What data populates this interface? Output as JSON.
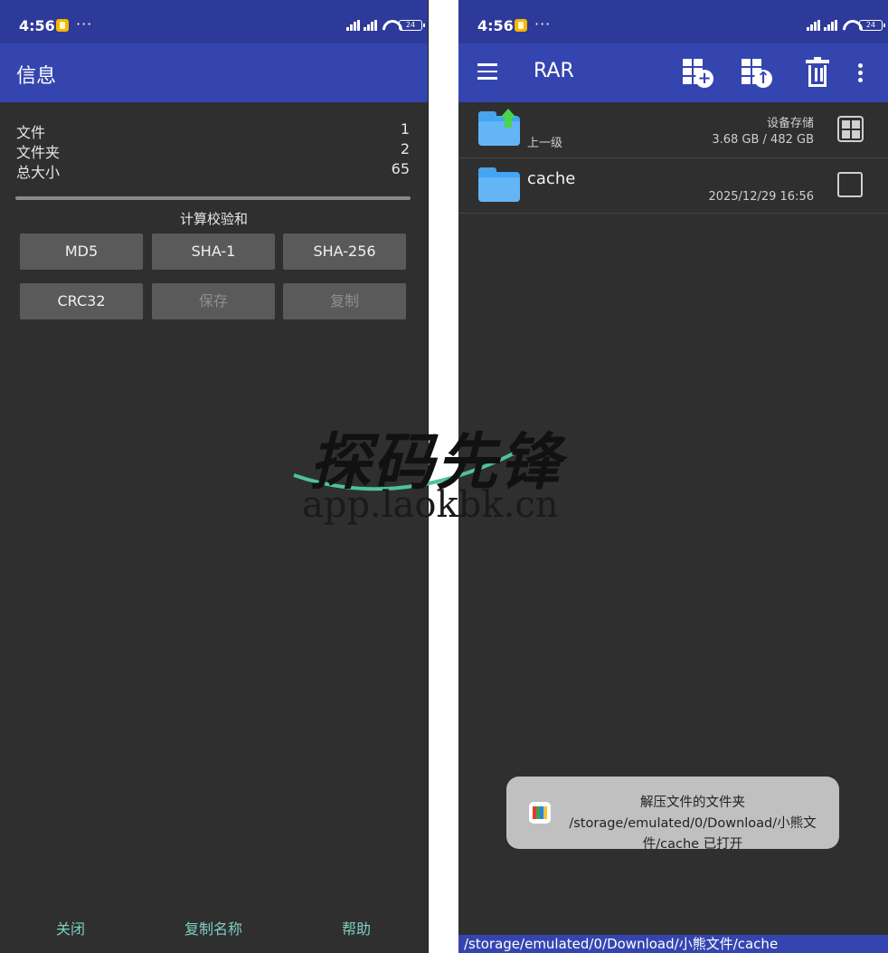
{
  "status_bar": {
    "time": "4:56",
    "dots": "···",
    "battery": "24"
  },
  "left": {
    "title": "信息",
    "info": [
      {
        "label": "文件",
        "value": "1"
      },
      {
        "label": "文件夹",
        "value": "2"
      },
      {
        "label": "总大小",
        "value": "65"
      }
    ],
    "checksum_title": "计算校验和",
    "buttons": [
      "MD5",
      "SHA-1",
      "SHA-256",
      "CRC32",
      "保存",
      "复制"
    ],
    "footer": {
      "close": "关闭",
      "copy_name": "复制名称",
      "help": "帮助"
    }
  },
  "right": {
    "title": "RAR",
    "files": [
      {
        "name": "",
        "sub": "上一级",
        "meta_top": "设备存储",
        "meta_bottom": "3.68 GB / 482 GB"
      },
      {
        "name": "cache",
        "sub": "",
        "meta_top": "",
        "meta_bottom": "2025/12/29 16:56"
      }
    ],
    "toast": "解压文件的文件夹 /storage/emulated/0/Download/小熊文件/cache 已打开",
    "path": "/storage/emulated/0/Download/小熊文件/cache"
  },
  "watermark": {
    "cn": "探码先锋",
    "url": "app.laokbk.cn"
  },
  "colors": {
    "appbar": "#3545b0",
    "statusbar": "#2e3a99",
    "background": "#2f2f2f",
    "accent": "#7ecfc0",
    "folder": "#42a5f5",
    "up_arrow": "#4cd34f"
  }
}
